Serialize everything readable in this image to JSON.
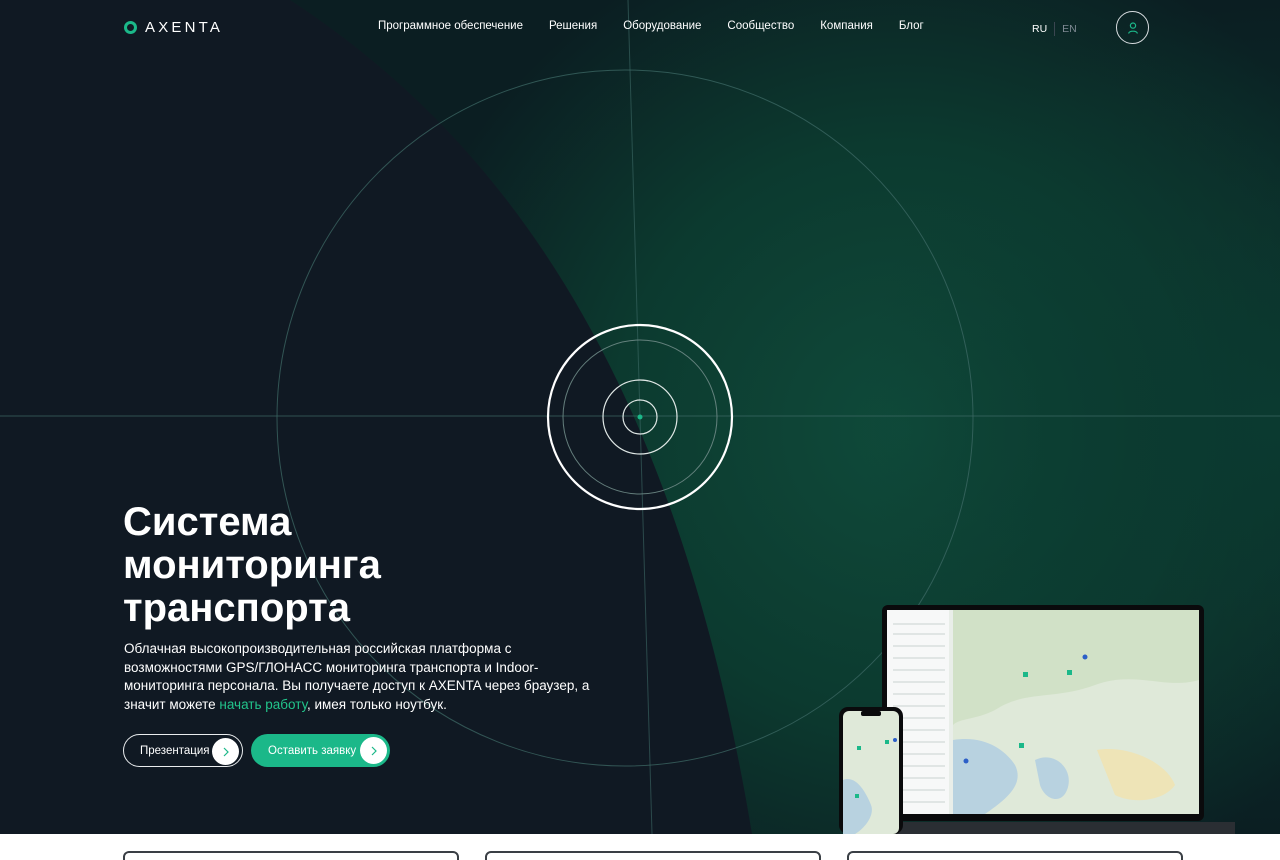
{
  "header": {
    "logo_text": "AXENTA",
    "nav": [
      "Программное обеспечение",
      "Решения",
      "Оборудование",
      "Сообщество",
      "Компания",
      "Блог"
    ],
    "lang_ru": "RU",
    "lang_en": "EN",
    "account_icon": "user-icon"
  },
  "hero": {
    "title": "Система мониторинга транспорта",
    "description_before": "Облачная высокопроизводительная российская платформа с возможностями GPS/ГЛОНАСС мониторинга транспорта и Indoor-мониторинга персонала. Вы получаете доступ к AXENTA через браузер, а значит можете ",
    "description_link": "начать работу",
    "description_after": ", имея только ноутбук.",
    "btn_presentation": "Презентация",
    "btn_request": "Оставить заявку",
    "btn_arrow_icon": "chevron-right-icon"
  },
  "colors": {
    "background": "#101923",
    "accent": "#1bb889",
    "accent_glow": "#0f4a3a",
    "link": "#22c48b"
  }
}
